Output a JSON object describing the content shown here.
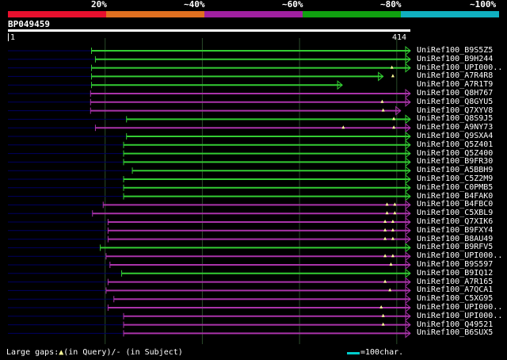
{
  "scale": {
    "bands": [
      {
        "label": "",
        "color": "#e8102e"
      },
      {
        "label": "20%",
        "color": "#e07020"
      },
      {
        "label": "~40%",
        "color": "#a020a0"
      },
      {
        "label": "~60%",
        "color": "#10a010"
      },
      {
        "label": "~80%",
        "color": "#10b0c0"
      }
    ],
    "end_label": "~100%"
  },
  "query": {
    "id": "BP049459",
    "start": "1",
    "end": "414",
    "length": 414
  },
  "colors": {
    "green": "#33cc33",
    "magenta": "#aa33aa",
    "bg_line": "#000060",
    "grid": "#2a4a2a",
    "gap": "#ffff99"
  },
  "hits": [
    {
      "name": "UniRef100_B9S5Z5",
      "start": 86,
      "end": 414,
      "color": "green",
      "gaps": []
    },
    {
      "name": "UniRef100_B9H244",
      "start": 90,
      "end": 414,
      "color": "green",
      "gaps": []
    },
    {
      "name": "UniRef100_UPI000..",
      "start": 86,
      "end": 414,
      "color": "green",
      "gaps": [
        395
      ]
    },
    {
      "name": "UniRef100_A7R4R8",
      "start": 86,
      "end": 386,
      "color": "green",
      "gaps": [
        396
      ]
    },
    {
      "name": "UniRef100_A7R1T9",
      "start": 86,
      "end": 344,
      "color": "green",
      "gaps": []
    },
    {
      "name": "UniRef100_Q8H767",
      "start": 85,
      "end": 414,
      "color": "magenta",
      "gaps": []
    },
    {
      "name": "UniRef100_Q8GYU5",
      "start": 85,
      "end": 414,
      "color": "magenta",
      "gaps": [
        385
      ]
    },
    {
      "name": "UniRef100_Q7XYV8",
      "start": 85,
      "end": 404,
      "color": "magenta",
      "gaps": [
        386
      ]
    },
    {
      "name": "UniRef100_Q8S9J5",
      "start": 122,
      "end": 414,
      "color": "green",
      "gaps": [
        397
      ]
    },
    {
      "name": "UniRef100_A9NY73",
      "start": 90,
      "end": 414,
      "color": "magenta",
      "gaps": [
        345,
        397
      ]
    },
    {
      "name": "UniRef100_Q9SXA4",
      "start": 122,
      "end": 414,
      "color": "green",
      "gaps": []
    },
    {
      "name": "UniRef100_Q5Z401",
      "start": 119,
      "end": 414,
      "color": "green",
      "gaps": []
    },
    {
      "name": "UniRef100_Q5Z400",
      "start": 119,
      "end": 414,
      "color": "green",
      "gaps": []
    },
    {
      "name": "UniRef100_B9FR30",
      "start": 119,
      "end": 414,
      "color": "green",
      "gaps": []
    },
    {
      "name": "UniRef100_A5BBH9",
      "start": 128,
      "end": 414,
      "color": "green",
      "gaps": []
    },
    {
      "name": "UniRef100_C5Z2M9",
      "start": 119,
      "end": 414,
      "color": "green",
      "gaps": []
    },
    {
      "name": "UniRef100_C0PMB5",
      "start": 119,
      "end": 414,
      "color": "green",
      "gaps": []
    },
    {
      "name": "UniRef100_B4FAK0",
      "start": 119,
      "end": 414,
      "color": "green",
      "gaps": []
    },
    {
      "name": "UniRef100_B4FBC0",
      "start": 98,
      "end": 414,
      "color": "magenta",
      "gaps": [
        390,
        398
      ]
    },
    {
      "name": "UniRef100_C5XBL9",
      "start": 87,
      "end": 414,
      "color": "magenta",
      "gaps": [
        390,
        398
      ]
    },
    {
      "name": "UniRef100_Q7XIK6",
      "start": 103,
      "end": 414,
      "color": "magenta",
      "gaps": [
        388,
        396
      ]
    },
    {
      "name": "UniRef100_B9FXY4",
      "start": 103,
      "end": 414,
      "color": "magenta",
      "gaps": [
        388,
        396
      ]
    },
    {
      "name": "UniRef100_B8AU49",
      "start": 103,
      "end": 414,
      "color": "magenta",
      "gaps": [
        388,
        396
      ]
    },
    {
      "name": "UniRef100_B9RFV5",
      "start": 95,
      "end": 414,
      "color": "green",
      "gaps": []
    },
    {
      "name": "UniRef100_UPI000..",
      "start": 101,
      "end": 414,
      "color": "magenta",
      "gaps": [
        388,
        396
      ]
    },
    {
      "name": "UniRef100_B9S597",
      "start": 105,
      "end": 414,
      "color": "magenta",
      "gaps": [
        394
      ]
    },
    {
      "name": "UniRef100_B9IQ12",
      "start": 117,
      "end": 414,
      "color": "green",
      "gaps": []
    },
    {
      "name": "UniRef100_A7R165",
      "start": 103,
      "end": 414,
      "color": "magenta",
      "gaps": [
        388
      ]
    },
    {
      "name": "UniRef100_A7QCA1",
      "start": 101,
      "end": 414,
      "color": "magenta",
      "gaps": [
        393
      ]
    },
    {
      "name": "UniRef100_C5XG95",
      "start": 109,
      "end": 414,
      "color": "magenta",
      "gaps": []
    },
    {
      "name": "UniRef100_UPI000..",
      "start": 103,
      "end": 414,
      "color": "magenta",
      "gaps": [
        384
      ]
    },
    {
      "name": "UniRef100_UPI000..",
      "start": 119,
      "end": 414,
      "color": "magenta",
      "gaps": [
        386
      ]
    },
    {
      "name": "UniRef100_Q49521",
      "start": 119,
      "end": 414,
      "color": "magenta",
      "gaps": [
        386
      ]
    },
    {
      "name": "UniRef100_B6SUX5",
      "start": 119,
      "end": 414,
      "color": "magenta",
      "gaps": []
    }
  ],
  "footer": {
    "large_gaps_label": "Large gaps:",
    "query_gap_glyph": "▲",
    "query_gap_text": "(in Query)/",
    "subject_gap_text": "- (in Subject)",
    "key_text": "=100char."
  }
}
